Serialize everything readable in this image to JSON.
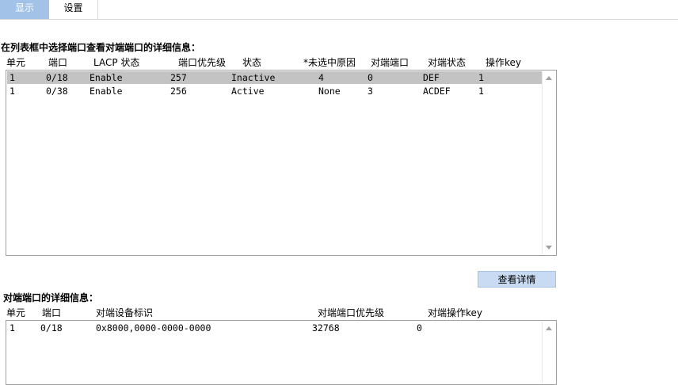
{
  "tabs": {
    "display": "显示",
    "settings": "设置"
  },
  "section1": {
    "title": "在列表框中选择端口查看对端端口的详细信息：",
    "headers": [
      "单元",
      "端口",
      "LACP 状态",
      "端口优先级",
      "状态",
      "*未选中原因",
      "对端端口",
      "对端状态",
      "操作key"
    ],
    "rows": [
      {
        "unit": "1",
        "port": "0/18",
        "lacp": "Enable",
        "priority": "257",
        "status": "Inactive",
        "reason": "4",
        "peer_port": "0",
        "peer_state": "DEF",
        "key": "1"
      },
      {
        "unit": "1",
        "port": "0/38",
        "lacp": "Enable",
        "priority": "256",
        "status": "Active",
        "reason": "None",
        "peer_port": "3",
        "peer_state": "ACDEF",
        "key": "1"
      }
    ],
    "selected_row": 0
  },
  "detail_button": "查看详情",
  "section2": {
    "title": "对端端口的详细信息：",
    "headers": [
      "单元",
      "端口",
      "对端设备标识",
      "对端端口优先级",
      "对端操作key"
    ],
    "rows": [
      {
        "unit": "1",
        "port": "0/18",
        "device_id": "0x8000,0000-0000-0000",
        "port_priority": "32768",
        "op_key": "0"
      }
    ]
  }
}
